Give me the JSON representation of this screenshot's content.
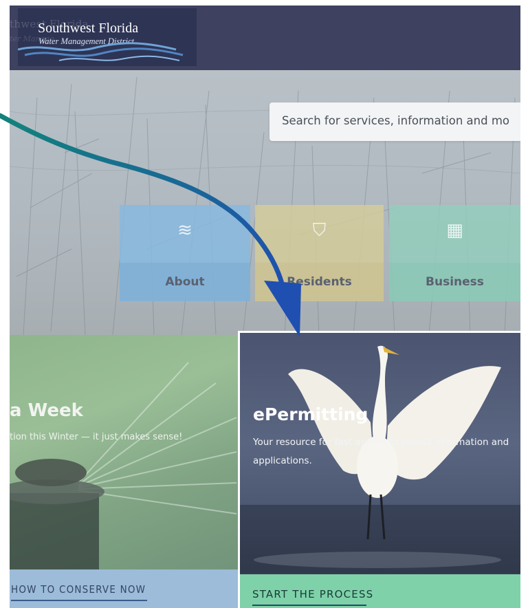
{
  "header": {
    "logo_name": "Southwest Florida",
    "logo_sub": "Water Management District",
    "logo_ghost_name": "thwest Florida",
    "logo_ghost_sub": "ter Manage"
  },
  "search": {
    "placeholder": "Search for services, information and mo"
  },
  "tiles": [
    {
      "label": "About",
      "icon": "water-waves-icon",
      "glyph": "≋",
      "color": "#86b9e0"
    },
    {
      "label": "Residents",
      "icon": "faucet-icon",
      "glyph": "⛉",
      "color": "#d4cb9a"
    },
    {
      "label": "Business",
      "icon": "building-icon",
      "glyph": "▦",
      "color": "#92cebc"
    }
  ],
  "card_left": {
    "title": "a Week",
    "subtitle": "tion this Winter — it just makes sense!",
    "cta": "HOW TO CONSERVE NOW",
    "cta_color": "#9cbcd9"
  },
  "card_right": {
    "title": "ePermitting",
    "description": "Your resource for fast access to permit information and applications.",
    "cta": "START THE PROCESS",
    "cta_color": "#7fd1a9"
  },
  "annotation": {
    "arrow_gradient": [
      "#12837a",
      "#1f4fb0"
    ]
  }
}
